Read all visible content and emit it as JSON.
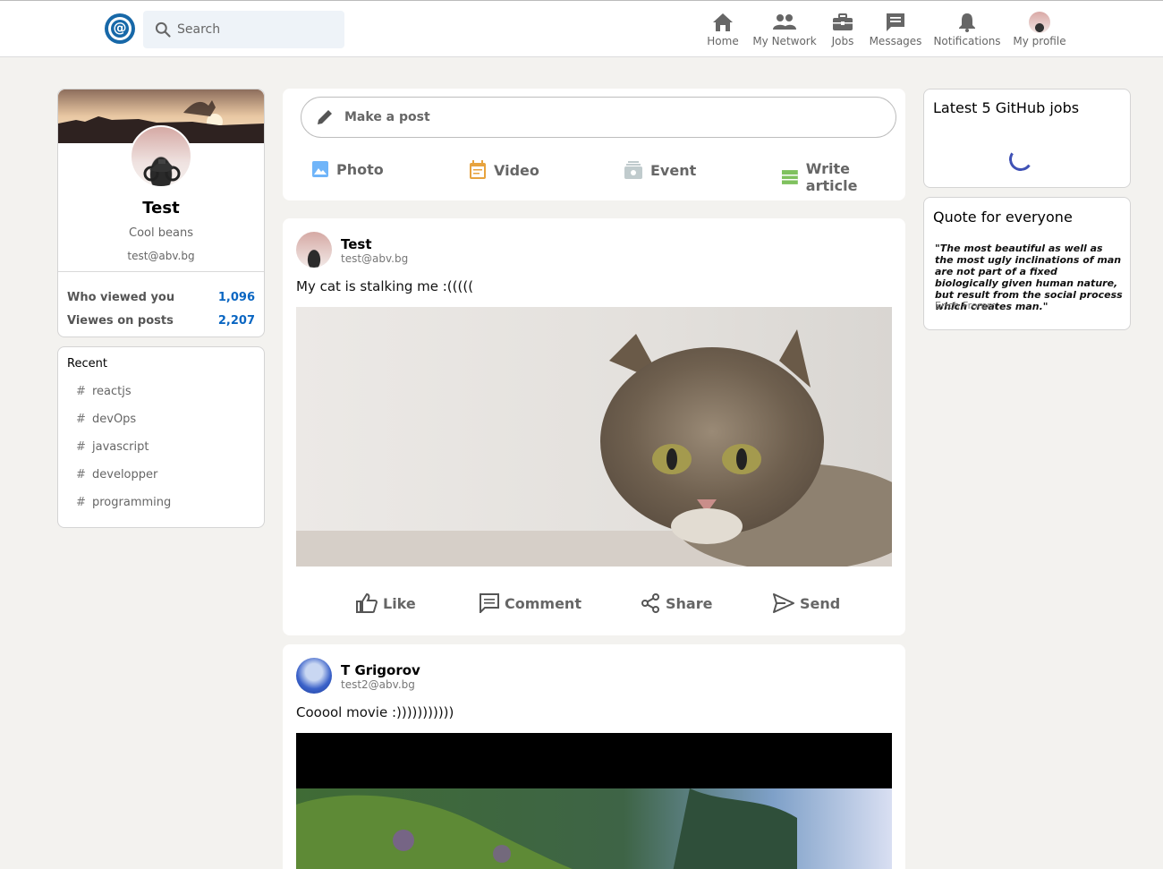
{
  "header": {
    "search_placeholder": "Search",
    "nav": [
      {
        "label": "Home",
        "icon": "home-icon"
      },
      {
        "label": "My Network",
        "icon": "network-icon"
      },
      {
        "label": "Jobs",
        "icon": "briefcase-icon"
      },
      {
        "label": "Messages",
        "icon": "message-icon"
      },
      {
        "label": "Notifications",
        "icon": "bell-icon"
      },
      {
        "label": "My profile",
        "icon": "avatar"
      }
    ]
  },
  "profile": {
    "name": "Test",
    "tagline": "Cool beans",
    "email": "test@abv.bg",
    "stats": [
      {
        "label": "Who viewed you",
        "value": "1,096"
      },
      {
        "label": "Viewes on posts",
        "value": "2,207"
      }
    ]
  },
  "recent": {
    "title": "Recent",
    "tags": [
      "reactjs",
      "devOps",
      "javascript",
      "developper",
      "programming"
    ]
  },
  "composer": {
    "placeholder": "Make a post",
    "actions": [
      {
        "label": "Photo",
        "icon": "photo-icon",
        "color": "#70b5f9"
      },
      {
        "label": "Video",
        "icon": "video-icon",
        "color": "#e7a33e"
      },
      {
        "label": "Event",
        "icon": "event-icon",
        "color": "#c0cbcd"
      },
      {
        "label": "Write article",
        "icon": "article-icon",
        "color": "#7fc15e"
      }
    ]
  },
  "posts": [
    {
      "author": "Test",
      "email": "test@abv.bg",
      "text": "My cat is stalking me :(((((",
      "media": "cat-photo"
    },
    {
      "author": "T Grigorov",
      "email": "test2@abv.bg",
      "text": "Cooool movie :)))))))))))",
      "media": "movie-still"
    }
  ],
  "reactions": [
    "Like",
    "Comment",
    "Share",
    "Send"
  ],
  "widgets": {
    "jobs_title": "Latest 5 GitHub jobs",
    "quote_title": "Quote for everyone",
    "quote_text": "\"The most beautiful as well as the most ugly inclinations of man are not part of a fixed biologically given human nature, but result from the social process which creates man.\"",
    "quote_author": "Erich Fromm"
  },
  "colors": {
    "accent": "#0a66c2",
    "brand": "#1768a8",
    "spinner": "#3f51b5"
  }
}
